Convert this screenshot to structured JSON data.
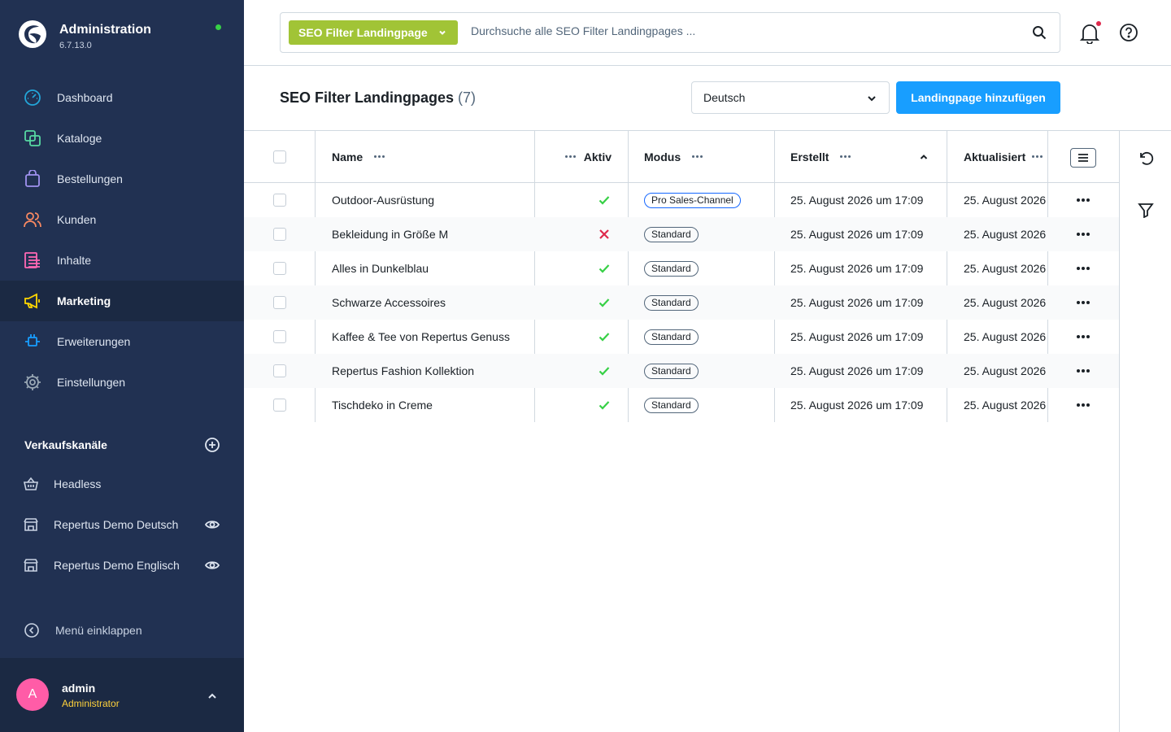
{
  "brand": {
    "title": "Administration",
    "version": "6.7.13.0"
  },
  "nav": [
    {
      "label": "Dashboard",
      "icon": "dashboard-icon",
      "color": "#23a5d8"
    },
    {
      "label": "Kataloge",
      "icon": "catalogue-icon",
      "color": "#57d9a3"
    },
    {
      "label": "Bestellungen",
      "icon": "orders-icon",
      "color": "#a092f0"
    },
    {
      "label": "Kunden",
      "icon": "customers-icon",
      "color": "#f88962"
    },
    {
      "label": "Inhalte",
      "icon": "content-icon",
      "color": "#ff68b4"
    },
    {
      "label": "Marketing",
      "icon": "marketing-icon",
      "color": "#ffd700",
      "active": true
    },
    {
      "label": "Erweiterungen",
      "icon": "extensions-icon",
      "color": "#189eff"
    },
    {
      "label": "Einstellungen",
      "icon": "settings-icon",
      "color": "#9aa8b5"
    }
  ],
  "sales_channels": {
    "title": "Verkaufskanäle",
    "items": [
      {
        "label": "Headless",
        "icon": "basket-icon"
      },
      {
        "label": "Repertus Demo Deutsch",
        "icon": "storefront-icon"
      },
      {
        "label": "Repertus Demo Englisch",
        "icon": "storefront-icon"
      }
    ]
  },
  "collapse_label": "Menü einklappen",
  "user": {
    "initial": "A",
    "name": "admin",
    "role": "Administrator"
  },
  "search": {
    "type_label": "SEO Filter Landingpage",
    "placeholder": "Durchsuche alle SEO Filter Landingpages ..."
  },
  "header": {
    "title": "SEO Filter Landingpages",
    "count": "(7)",
    "language": "Deutsch",
    "add_button": "Landingpage hinzufügen"
  },
  "columns": {
    "name": "Name",
    "active": "Aktiv",
    "mode": "Modus",
    "created": "Erstellt",
    "updated": "Aktualisiert"
  },
  "rows": [
    {
      "name": "Outdoor-Ausrüstung",
      "active": true,
      "mode": "Pro Sales-Channel",
      "created": "25. August 2026 um 17:09",
      "updated": "25. August 2026"
    },
    {
      "name": "Bekleidung in Größe M",
      "active": false,
      "mode": "Standard",
      "created": "25. August 2026 um 17:09",
      "updated": "25. August 2026"
    },
    {
      "name": "Alles in Dunkelblau",
      "active": true,
      "mode": "Standard",
      "created": "25. August 2026 um 17:09",
      "updated": "25. August 2026"
    },
    {
      "name": "Schwarze Accessoires",
      "active": true,
      "mode": "Standard",
      "created": "25. August 2026 um 17:09",
      "updated": "25. August 2026"
    },
    {
      "name": "Kaffee & Tee von Repertus Genuss",
      "active": true,
      "mode": "Standard",
      "created": "25. August 2026 um 17:09",
      "updated": "25. August 2026"
    },
    {
      "name": "Repertus Fashion Kollektion",
      "active": true,
      "mode": "Standard",
      "created": "25. August 2026 um 17:09",
      "updated": "25. August 2026"
    },
    {
      "name": "Tischdeko in Creme",
      "active": true,
      "mode": "Standard",
      "created": "25. August 2026 um 17:09",
      "updated": "25. August 2026"
    }
  ]
}
